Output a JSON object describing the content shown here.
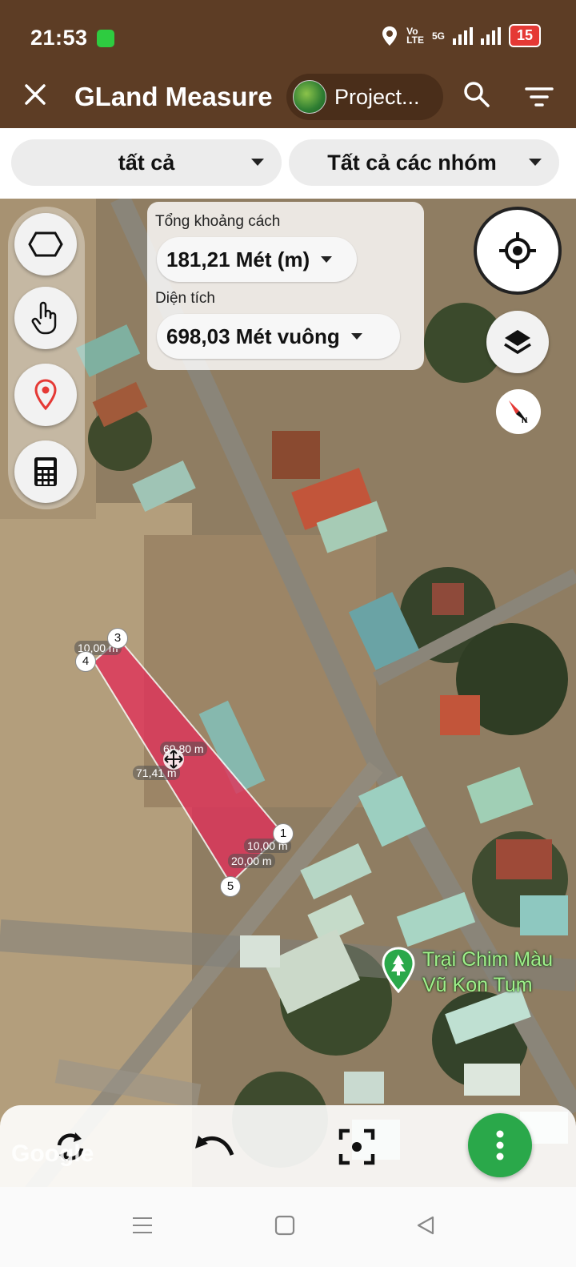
{
  "status": {
    "time": "21:53",
    "network_top": "Vo",
    "network_bottom": "LTE",
    "net_type": "5G",
    "battery": "15"
  },
  "appbar": {
    "title": "GLand Measure",
    "project": "Project..."
  },
  "filters": {
    "left": "tất cả",
    "right": "Tất cả các nhóm"
  },
  "measure": {
    "distance_label": "Tổng khoảng cách",
    "distance_value": "181,21 Mét (m)",
    "area_label": "Diện tích",
    "area_value": "698,03 Mét vuông"
  },
  "polygon": {
    "color": "#e0325a",
    "vertices": [
      {
        "num": "1"
      },
      {
        "num": "3"
      },
      {
        "num": "4"
      },
      {
        "num": "5"
      }
    ],
    "segment_labels": [
      "10,00 m",
      "69,80 m",
      "71,41 m",
      "10,00 m",
      "20,00 m"
    ]
  },
  "poi": {
    "line1": "Trại Chim Màu",
    "line2": "Vũ Kon Tum"
  },
  "map_attribution": "Google",
  "colors": {
    "brand": "#5d3d25",
    "fab": "#2aa84a",
    "battery": "#e53935",
    "poi_text": "#9ef08a"
  },
  "icons": {
    "tools": [
      "polygon-icon",
      "hand-pointer-icon",
      "map-pin-icon",
      "calculator-icon"
    ],
    "bottom": [
      "sync-icon",
      "undo-icon",
      "focus-icon",
      "more-vertical-icon"
    ],
    "nav": [
      "menu-icon",
      "home-icon",
      "back-icon"
    ]
  }
}
